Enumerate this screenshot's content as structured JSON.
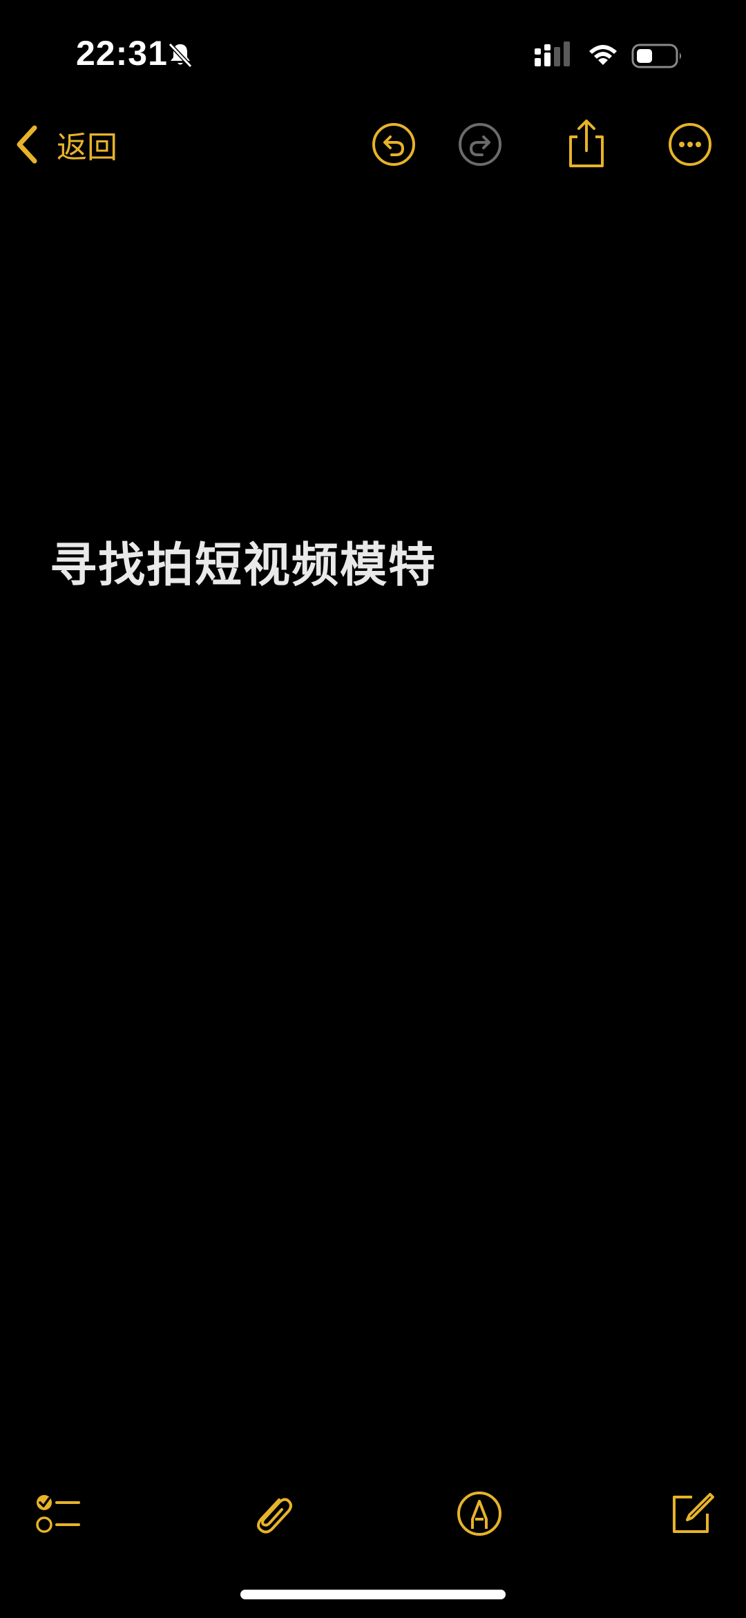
{
  "status_bar": {
    "time": "22:31",
    "icons": [
      "bell-slash-icon",
      "cellular-signal-icon",
      "wifi-icon",
      "battery-icon"
    ]
  },
  "nav": {
    "back_label": "返回",
    "icons": [
      "chevron-left-icon",
      "undo-icon",
      "redo-icon",
      "share-icon",
      "more-icon"
    ]
  },
  "note": {
    "title": "寻找拍短视频模特"
  },
  "toolbar": {
    "icons": [
      "checklist-icon",
      "paperclip-icon",
      "markup-pen-icon",
      "compose-icon"
    ]
  },
  "colors": {
    "background": "#000000",
    "accent": "#e7b32a",
    "disabled": "#6b6b6b",
    "text": "#e9e9e9"
  }
}
